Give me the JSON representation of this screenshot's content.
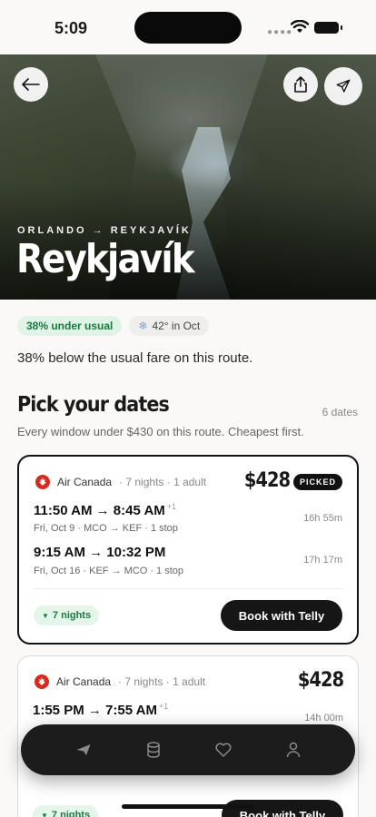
{
  "status": {
    "time": "5:09"
  },
  "hero": {
    "route": "ORLANDO → REYKJAVÍK",
    "city": "Reykjavík"
  },
  "chips": {
    "deal": "38% under usual",
    "weather": "42° in Oct"
  },
  "note": "38% below the usual fare on this route.",
  "section": {
    "title": "Pick your dates",
    "count": "6 dates",
    "subtitle": "Every window under $430 on this route. Cheapest first."
  },
  "cards": [
    {
      "airline": "Air Canada",
      "meta": "· 7 nights · 1 adult",
      "price": "$428",
      "badge": "PICKED",
      "outbound": {
        "times": "11:50 AM → 8:45 AM",
        "plus": "+1",
        "detail": "Fri, Oct 9 · MCO → KEF · 1 stop",
        "duration": "16h 55m"
      },
      "return": {
        "times": "9:15 AM → 10:32 PM",
        "detail": "Fri, Oct 16 · KEF → MCO · 1 stop",
        "duration": "17h 17m"
      },
      "nights": "7 nights",
      "cta": "Book with Telly"
    },
    {
      "airline": "Air Canada",
      "meta": "· 7 nights · 1 adult",
      "price": "$428",
      "outbound": {
        "times": "1:55 PM → 7:55 AM",
        "plus": "+1",
        "duration": "14h 00m"
      },
      "nights": "7 nights",
      "cta": "Book with Telly"
    }
  ],
  "icons": {
    "back": "arrow-left-icon",
    "share": "share-icon",
    "plane": "plane-icon",
    "maple": "maple-leaf-icon",
    "snow": "snowflake-icon"
  },
  "tabs": [
    "plane-icon",
    "database-icon",
    "heart-icon",
    "person-icon"
  ],
  "colors": {
    "accent_green": "#167a3e",
    "dark": "#161616",
    "maple_red": "#d52b1e"
  }
}
